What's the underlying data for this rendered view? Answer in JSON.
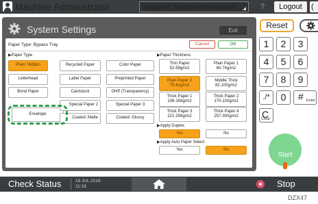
{
  "topbar": {
    "title": "Machine Administrator",
    "login_status": "Logged in: Machine Administrator",
    "help_label": "?",
    "logout_label": "Logout",
    "power_label": "(",
    "bg_color": "#3a3d3f"
  },
  "panel": {
    "title": "System Settings",
    "exit_label": "Exit",
    "paper_type_label": "Paper Type: Bypass Tray",
    "cancel_label": "Cancel",
    "ok_label": "OK"
  },
  "paper_type": {
    "label": "▶Paper Type",
    "options": [
      {
        "label": "Plain: Hidden",
        "selected": true
      },
      {
        "label": "Recycled Paper",
        "selected": false
      },
      {
        "label": "Color Paper",
        "selected": false
      },
      {
        "label": "Letterhead",
        "selected": false
      },
      {
        "label": "Label Paper",
        "selected": false
      },
      {
        "label": "Preprinted Paper",
        "selected": false
      },
      {
        "label": "Bond Paper",
        "selected": false
      },
      {
        "label": "Cardstock",
        "selected": false
      },
      {
        "label": "OHP (Transparency)",
        "selected": false
      },
      {
        "label": "Envelope",
        "selected": false
      },
      {
        "label": "Special Paper 2",
        "selected": false
      },
      {
        "label": "Special Paper 3",
        "selected": false
      },
      {
        "label": "Coated: Matte",
        "selected": false
      },
      {
        "label": "Coated: Glossy",
        "selected": false
      }
    ]
  },
  "paper_thickness": {
    "label": "▶Paper Thickness",
    "options": [
      {
        "label": "Thin Paper\n52-59g/m2",
        "selected": false
      },
      {
        "label": "Plain Paper 1\n60-74g/m2",
        "selected": false
      },
      {
        "label": "Plain Paper 2\n75-81g/m2",
        "selected": true
      },
      {
        "label": "Middle Thick\n82-105g/m2",
        "selected": false
      },
      {
        "label": "Thick Paper 1\n106-169g/m2",
        "selected": false
      },
      {
        "label": "Thick Paper 2\n170-220g/m2",
        "selected": false
      },
      {
        "label": "Thick Paper 3\n221-256g/m2",
        "selected": false
      },
      {
        "label": "Thick Paper 4\n257-300g/m2",
        "selected": false
      }
    ]
  },
  "apply_duplex": {
    "label": "▶Apply Duplex",
    "yes_label": "Yes",
    "no_label": "No",
    "selected": "Yes"
  },
  "apply_auto_paper_select": {
    "label": "▶Apply Auto Paper Select",
    "yes_label": "Yes",
    "no_label": "No",
    "selected": "No"
  },
  "keypad": {
    "reset_label": "Reset",
    "keys": [
      "1",
      "2",
      "3",
      "4",
      "5",
      "6",
      "7",
      "8",
      "9",
      "./*",
      "0",
      "#"
    ],
    "enter_label": "Enter",
    "clear_key": "C",
    "clear_label": "Clear",
    "start_label": "Start"
  },
  "bottombar": {
    "check_status_label": "Check Status",
    "datetime": "18 JUL 2018\n11:18",
    "stop_label": "Stop"
  },
  "image_code": "DZX47",
  "colors": {
    "selected": "#f7a21b",
    "callout": "#2f9e4e",
    "start": "#7ed690",
    "reset_border": "#f0a430"
  }
}
